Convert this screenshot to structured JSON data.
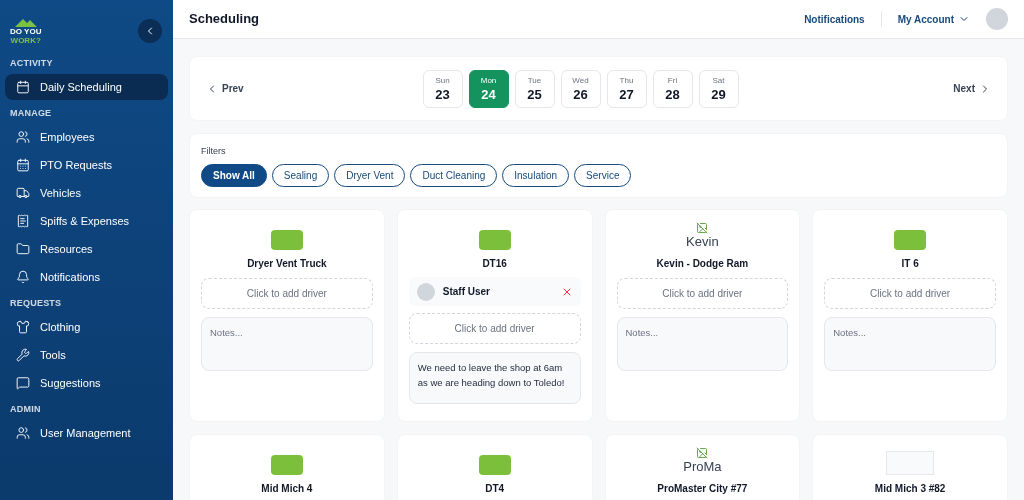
{
  "sidebar": {
    "logo": {
      "line1": "DO YOU",
      "line2": "WORK?"
    },
    "sections": [
      {
        "title": "ACTIVITY",
        "items": [
          {
            "label": "Daily Scheduling",
            "selected": true
          }
        ]
      },
      {
        "title": "MANAGE",
        "items": [
          {
            "label": "Employees",
            "selected": false
          },
          {
            "label": "PTO Requests",
            "selected": false
          },
          {
            "label": "Vehicles",
            "selected": false
          },
          {
            "label": "Spiffs & Expenses",
            "selected": false
          },
          {
            "label": "Resources",
            "selected": false
          },
          {
            "label": "Notifications",
            "selected": false
          }
        ]
      },
      {
        "title": "REQUESTS",
        "items": [
          {
            "label": "Clothing",
            "selected": false
          },
          {
            "label": "Tools",
            "selected": false
          },
          {
            "label": "Suggestions",
            "selected": false
          }
        ]
      },
      {
        "title": "ADMIN",
        "items": [
          {
            "label": "User Management",
            "selected": false
          }
        ]
      }
    ]
  },
  "header": {
    "title": "Scheduling",
    "notifications": "Notifications",
    "account": "My Account"
  },
  "week": {
    "prev": "Prev",
    "next": "Next",
    "days": [
      {
        "weekday": "Sun",
        "date": "23",
        "selected": false
      },
      {
        "weekday": "Mon",
        "date": "24",
        "selected": true
      },
      {
        "weekday": "Tue",
        "date": "25",
        "selected": false
      },
      {
        "weekday": "Wed",
        "date": "26",
        "selected": false
      },
      {
        "weekday": "Thu",
        "date": "27",
        "selected": false
      },
      {
        "weekday": "Fri",
        "date": "28",
        "selected": false
      },
      {
        "weekday": "Sat",
        "date": "29",
        "selected": false
      }
    ]
  },
  "filters": {
    "label": "Filters",
    "options": [
      {
        "label": "Show All",
        "selected": true
      },
      {
        "label": "Sealing",
        "selected": false
      },
      {
        "label": "Dryer Vent",
        "selected": false
      },
      {
        "label": "Duct Cleaning",
        "selected": false
      },
      {
        "label": "Insulation",
        "selected": false
      },
      {
        "label": "Service",
        "selected": false
      }
    ]
  },
  "vehicles": [
    {
      "name": "Dryer Vent Truck",
      "image": {
        "kind": "photo"
      },
      "add_driver": "Click to add driver",
      "notes": {
        "placeholder": "Notes..."
      }
    },
    {
      "name": "DT16",
      "image": {
        "kind": "photo"
      },
      "drivers": [
        {
          "name": "Staff User"
        }
      ],
      "add_driver": "Click to add driver",
      "notes": {
        "value": "We need to leave the shop at 6am as we are heading down to Toledo!"
      }
    },
    {
      "name": "Kevin - Dodge Ram",
      "image": {
        "kind": "broken",
        "alt": "Kevin"
      },
      "add_driver": "Click to add driver",
      "notes": {
        "placeholder": "Notes..."
      }
    },
    {
      "name": "IT 6",
      "image": {
        "kind": "photo"
      },
      "add_driver": "Click to add driver",
      "notes": {
        "placeholder": "Notes..."
      }
    },
    {
      "name": "Mid Mich 4",
      "image": {
        "kind": "photo"
      }
    },
    {
      "name": "DT4",
      "image": {
        "kind": "photo"
      }
    },
    {
      "name": "ProMaster City #77",
      "image": {
        "kind": "broken",
        "alt": "ProMa"
      }
    },
    {
      "name": "Mid Mich 3 #82",
      "image": {
        "kind": "placeholder"
      }
    }
  ]
}
